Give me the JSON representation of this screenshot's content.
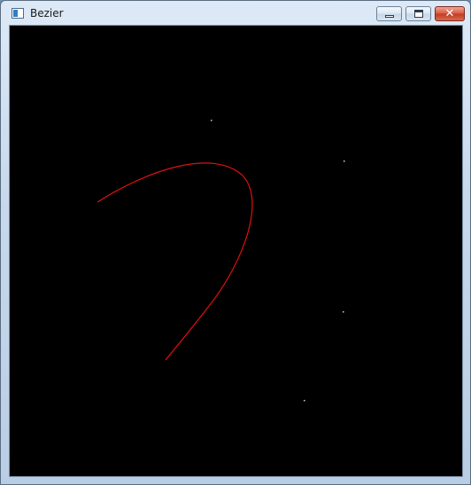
{
  "window": {
    "title": "Bezier"
  },
  "titlebar": {
    "buttons": [
      {
        "name": "minimize",
        "icon": "minimize-icon"
      },
      {
        "name": "maximize",
        "icon": "maximize-icon"
      },
      {
        "name": "close",
        "icon": "close-icon"
      }
    ]
  },
  "canvas": {
    "background": "#000000",
    "curve_color": "#e01010",
    "point_color": "#cfcfcf"
  }
}
